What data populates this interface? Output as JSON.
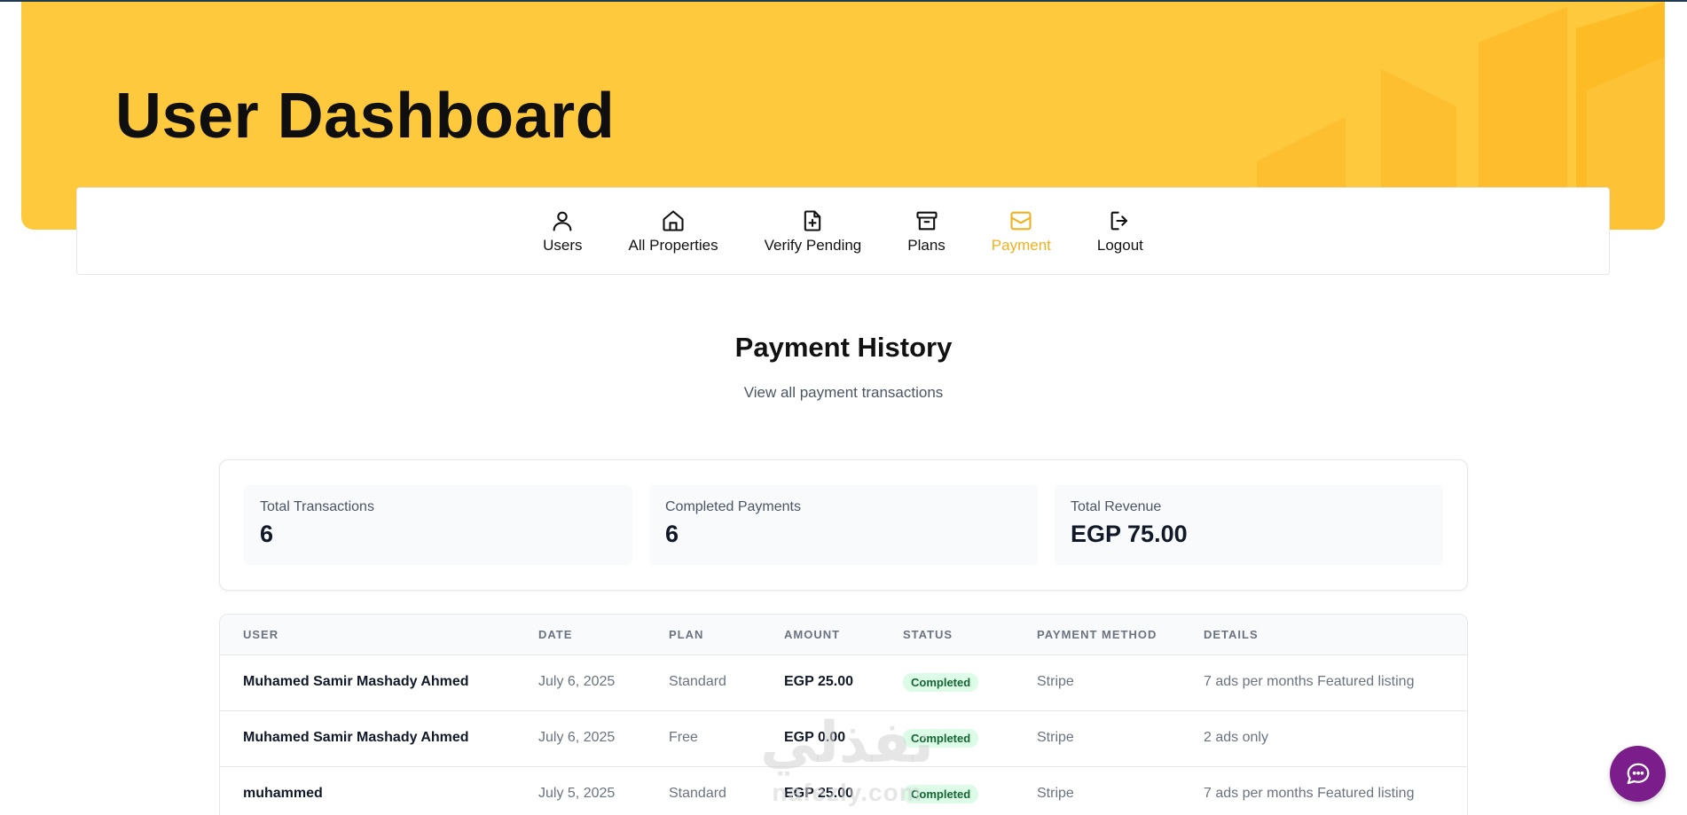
{
  "header": {
    "title": "User Dashboard"
  },
  "nav": {
    "items": [
      {
        "label": "Users",
        "icon": "user-icon"
      },
      {
        "label": "All Properties",
        "icon": "home-icon"
      },
      {
        "label": "Verify Pending",
        "icon": "file-plus-icon"
      },
      {
        "label": "Plans",
        "icon": "archive-icon"
      },
      {
        "label": "Payment",
        "icon": "mail-icon",
        "active": true
      },
      {
        "label": "Logout",
        "icon": "logout-icon"
      }
    ]
  },
  "section": {
    "title": "Payment History",
    "subtitle": "View all payment transactions"
  },
  "stats": [
    {
      "label": "Total Transactions",
      "value": "6"
    },
    {
      "label": "Completed Payments",
      "value": "6"
    },
    {
      "label": "Total Revenue",
      "value": "EGP 75.00"
    }
  ],
  "table": {
    "columns": [
      "USER",
      "DATE",
      "PLAN",
      "AMOUNT",
      "STATUS",
      "PAYMENT METHOD",
      "DETAILS"
    ],
    "rows": [
      {
        "user": "Muhamed Samir Mashady Ahmed",
        "date": "July 6, 2025",
        "plan": "Standard",
        "amount": "EGP 25.00",
        "status": "Completed",
        "method": "Stripe",
        "details": "7 ads per months Featured listing"
      },
      {
        "user": "Muhamed Samir Mashady Ahmed",
        "date": "July 6, 2025",
        "plan": "Free",
        "amount": "EGP 0.00",
        "status": "Completed",
        "method": "Stripe",
        "details": "2 ads only"
      },
      {
        "user": "muhammed",
        "date": "July 5, 2025",
        "plan": "Standard",
        "amount": "EGP 25.00",
        "status": "Completed",
        "method": "Stripe",
        "details": "7 ads per months Featured listing"
      }
    ]
  },
  "watermark": {
    "arabic": "نفذلي",
    "latin": "nafezly.com"
  },
  "colors": {
    "hero": "#fec93c",
    "accent": "#f2b01e",
    "badge_bg": "#dcfce7",
    "badge_text": "#166534",
    "chat": "#7b1e8c"
  }
}
